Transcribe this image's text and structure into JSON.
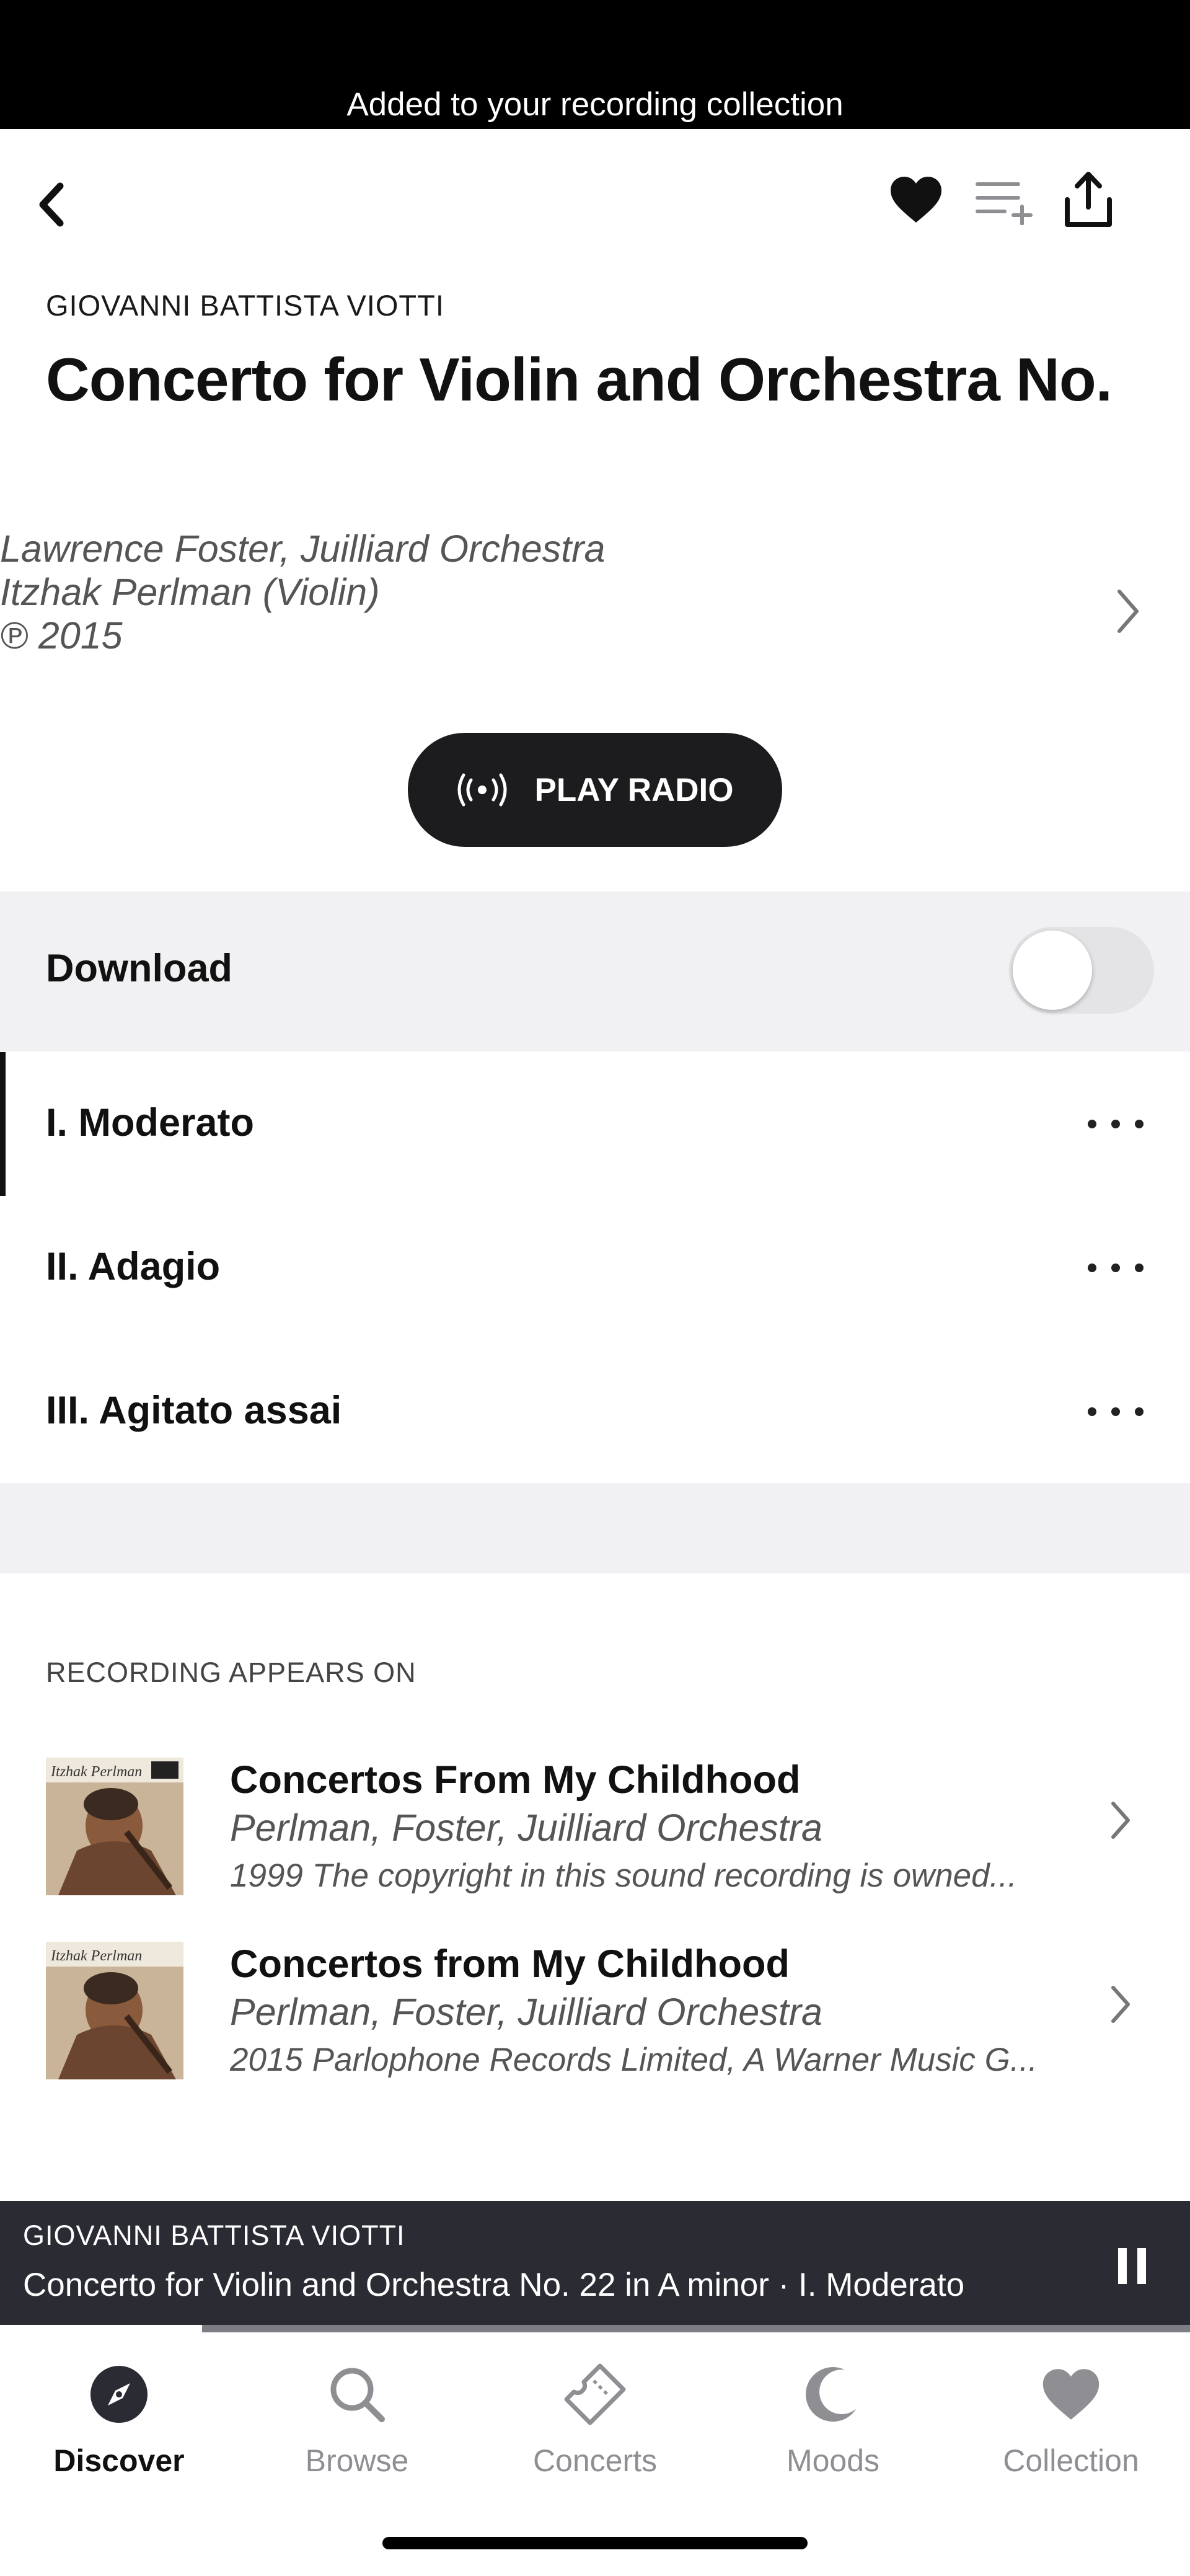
{
  "banner": {
    "text": "Added to your recording collection"
  },
  "header": {
    "back_icon": "chevron-left-icon",
    "actions": [
      "heart-icon",
      "add-to-queue-icon",
      "share-icon"
    ]
  },
  "work": {
    "composer": "GIOVANNI BATTISTA VIOTTI",
    "title": "Concerto for Violin and Orchestra No.",
    "performers": [
      "Lawrence Foster, Juilliard Orchestra",
      "Itzhak Perlman (Violin)"
    ],
    "year": "℗ 2015"
  },
  "play_radio": {
    "label": "PLAY RADIO",
    "icon": "radio-broadcast-icon"
  },
  "download": {
    "label": "Download",
    "enabled": false
  },
  "tracks": [
    {
      "label": "I. Moderato",
      "playing": true
    },
    {
      "label": "II. Adagio",
      "playing": false
    },
    {
      "label": "III. Agitato assai",
      "playing": false
    }
  ],
  "appears_on": {
    "heading": "RECORDING APPEARS ON",
    "albums": [
      {
        "title": "Concertos From My Childhood",
        "artist": "Perlman, Foster, Juilliard Orchestra",
        "note": "1999 The copyright in this sound recording is owned...",
        "cover_text": "Itzhak Perlman"
      },
      {
        "title": "Concertos from  My Childhood",
        "artist": "Perlman, Foster, Juilliard Orchestra",
        "note": "2015 Parlophone Records Limited, A Warner Music G...",
        "cover_text": "Itzhak Perlman"
      }
    ]
  },
  "player": {
    "composer": "GIOVANNI BATTISTA VIOTTI",
    "title": "Concerto for Violin and Orchestra No. 22 in A minor  ·  I. Moderato",
    "progress": 0.17,
    "state_icon": "pause-icon"
  },
  "tabs": [
    {
      "label": "Discover",
      "icon": "compass-icon",
      "active": true
    },
    {
      "label": "Browse",
      "icon": "search-icon",
      "active": false
    },
    {
      "label": "Concerts",
      "icon": "ticket-icon",
      "active": false
    },
    {
      "label": "Moods",
      "icon": "moon-icon",
      "active": false
    },
    {
      "label": "Collection",
      "icon": "heart-icon",
      "active": false
    }
  ],
  "colors": {
    "banner_bg": "#000000",
    "button_dark": "#1c1c1e",
    "band_gray": "#f1f1f4",
    "player_bg": "#2b2c33",
    "inactive_tab": "#8e8e93"
  }
}
